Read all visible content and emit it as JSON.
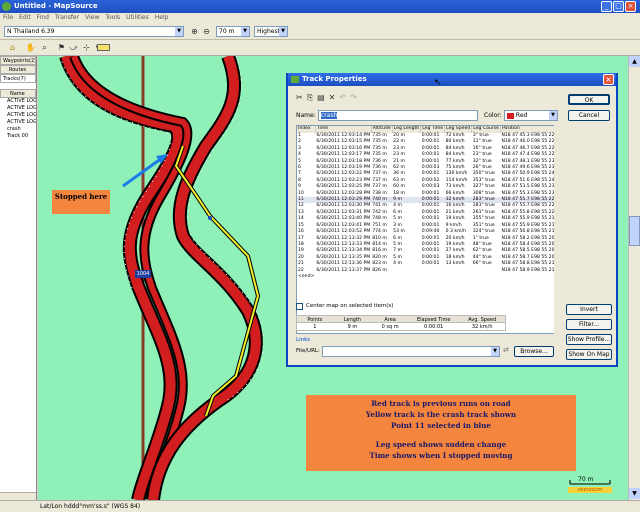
{
  "window": {
    "title": "Untitled - MapSource"
  },
  "menu": [
    "File",
    "Edit",
    "Find",
    "Transfer",
    "View",
    "Tools",
    "Utilities",
    "Help"
  ],
  "toolbar": {
    "map_product": "N Thailand 6.39",
    "zoom": "70 m",
    "detail": "Highest"
  },
  "sidebar": {
    "tab_waypoints": "Waypoints(2)",
    "tab_routes": "Routes",
    "tab_tracks": "Tracks(7)",
    "header": "Name",
    "items": [
      "ACTIVE LOG",
      "ACTIVE LOG",
      "ACTIVE LOG",
      "ACTIVE LOG",
      "crash",
      "Track 00"
    ]
  },
  "map": {
    "waypoint_label": "1004",
    "scale_label": "70 m",
    "logo_text": "overzoom"
  },
  "status": {
    "text": "Lat/Lon hddd°mm'ss.s\" (WGS 84)"
  },
  "annotations": {
    "stopped": "Stopped here",
    "lines": [
      "Red track is previous runs on road",
      "Yellow track is the crash track shown",
      "Point 11 selected in blue",
      "",
      "Leg speed shows sudden change",
      "Time shows when I stopped moving"
    ]
  },
  "dialog": {
    "title": "Track Properties",
    "name_label": "Name:",
    "name_value": "crash",
    "color_label": "Color:",
    "color_value": "Red",
    "ok": "OK",
    "cancel": "Cancel",
    "columns": [
      "Index",
      "Time",
      "Altitude",
      "Leg Length",
      "Leg Time",
      "Leg Speed",
      "Leg Course",
      "Position"
    ],
    "rows": [
      [
        "1",
        "6/30/2011 12:03:14 PM",
        "735 m",
        "20 m",
        "0:00:01",
        "72 km/h",
        "3° true",
        "N18 47 45.3 E98 55 22.5"
      ],
      [
        "2",
        "6/30/2011 12:03:15 PM",
        "735 m",
        "22 m",
        "0:00:01",
        "80 km/h",
        "11° true",
        "N18 47 46.0 E98 55 22.6"
      ],
      [
        "3",
        "6/30/2011 12:03:16 PM",
        "735 m",
        "23 m",
        "0:00:01",
        "84 km/h",
        "16° true",
        "N18 47 46.7 E98 55 22.9"
      ],
      [
        "4",
        "6/30/2011 12:03:17 PM",
        "735 m",
        "23 m",
        "0:00:01",
        "84 km/h",
        "23° true",
        "N18 47 47.4 E98 55 22.9"
      ],
      [
        "5",
        "6/30/2011 12:03:18 PM",
        "736 m",
        "21 m",
        "0:00:01",
        "77 km/h",
        "32° true",
        "N18 47 48.1 E98 55 23.2"
      ],
      [
        "6",
        "6/30/2011 12:03:19 PM",
        "736 m",
        "62 m",
        "0:00:03",
        "75 km/h",
        "26° true",
        "N18 47 49.6 E98 55 23.6"
      ],
      [
        "7",
        "6/30/2011 12:03:22 PM",
        "737 m",
        "36 m",
        "0:00:01",
        "130 km/h",
        "350° true",
        "N18 47 50.9 E98 55 24.5"
      ],
      [
        "8",
        "6/30/2011 12:03:23 PM",
        "737 m",
        "63 m",
        "0:00:02",
        "114 km/h",
        "353° true",
        "N18 47 51.6 E98 55 24.1"
      ],
      [
        "9",
        "6/30/2011 12:03:25 PM",
        "737 m",
        "60 m",
        "0:00:03",
        "73 km/h",
        "327° true",
        "N18 47 53.5 E98 55 23.4"
      ],
      [
        "10",
        "6/30/2011 12:03:28 PM",
        "738 m",
        "18 m",
        "0:00:01",
        "66 km/h",
        "308° true",
        "N18 47 55.3 E98 55 23.0"
      ],
      [
        "11",
        "6/30/2011 12:03:29 PM",
        "740 m",
        "9 m",
        "0:00:01",
        "32 km/h",
        "283° true",
        "N18 47 55.7 E98 55 22.5"
      ],
      [
        "12",
        "6/30/2011 12:03:30 PM",
        "741 m",
        "4 m",
        "0:00:01",
        "16 km/h",
        "283° true",
        "N18 47 55.7 E98 55 22.2"
      ],
      [
        "13",
        "6/30/2011 12:03:31 PM",
        "742 m",
        "6 m",
        "0:00:01",
        "21 km/h",
        "261° true",
        "N18 47 55.8 E98 55 22.1"
      ],
      [
        "14",
        "6/30/2011 12:03:40 PM",
        "748 m",
        "5 m",
        "0:00:01",
        "19 km/h",
        "355° true",
        "N18 47 55.9 E98 55 21.7"
      ],
      [
        "15",
        "6/30/2011 12:03:41 PM",
        "751 m",
        "3 m",
        "0:00:01",
        "9 km/h",
        "351° true",
        "N18 47 55.9 E98 55 21.6"
      ],
      [
        "16",
        "6/30/2011 12:03:52 PM",
        "774 m",
        "53 m",
        "0:09:40",
        "0.3 km/h",
        "324° true",
        "N18 47 56.8 E98 55 21.7"
      ],
      [
        "17",
        "6/30/2011 12:13:32 PM",
        "810 m",
        "6 m",
        "0:00:01",
        "20 km/h",
        "1° true",
        "N18 47 58.2 E98 55 20.6"
      ],
      [
        "18",
        "6/30/2011 12:13:33 PM",
        "814 m",
        "5 m",
        "0:00:01",
        "19 km/h",
        "48° true",
        "N18 47 58.4 E98 55 20.6"
      ],
      [
        "19",
        "6/30/2011 12:13:34 PM",
        "816 m",
        "7 m",
        "0:00:01",
        "27 km/h",
        "62° true",
        "N18 47 58.5 E98 55 20.7"
      ],
      [
        "20",
        "6/30/2011 12:13:35 PM",
        "820 m",
        "5 m",
        "0:00:01",
        "18 km/h",
        "44° true",
        "N18 47 58.7 E98 55 20.9"
      ],
      [
        "21",
        "6/30/2011 12:13:36 PM",
        "823 m",
        "4 m",
        "0:00:01",
        "13 km/h",
        "66° true",
        "N18 47 58.8 E98 55 21.0"
      ],
      [
        "22",
        "6/30/2011 12:13:37 PM",
        "826 m",
        "",
        "",
        "",
        "",
        "N18 47 58.9 E98 55 21.0"
      ],
      [
        "<end>",
        "",
        "",
        "",
        "",
        "",
        "",
        ""
      ]
    ],
    "selected_row": 10,
    "invert": "Invert",
    "filter": "Filter...",
    "center_map_label": "Center map on selected item(s)",
    "summary_headers": [
      "Points",
      "Length",
      "Area",
      "Elapsed Time",
      "Avg. Speed"
    ],
    "summary_values": [
      "1",
      "9 m",
      "0 sq m",
      "0:00:01",
      "32 km/h"
    ],
    "links_label": "Links",
    "file_url_label": "File/URL:",
    "browse": "Browse...",
    "show_profile": "Show Profile...",
    "show_on_map": "Show On Map"
  }
}
